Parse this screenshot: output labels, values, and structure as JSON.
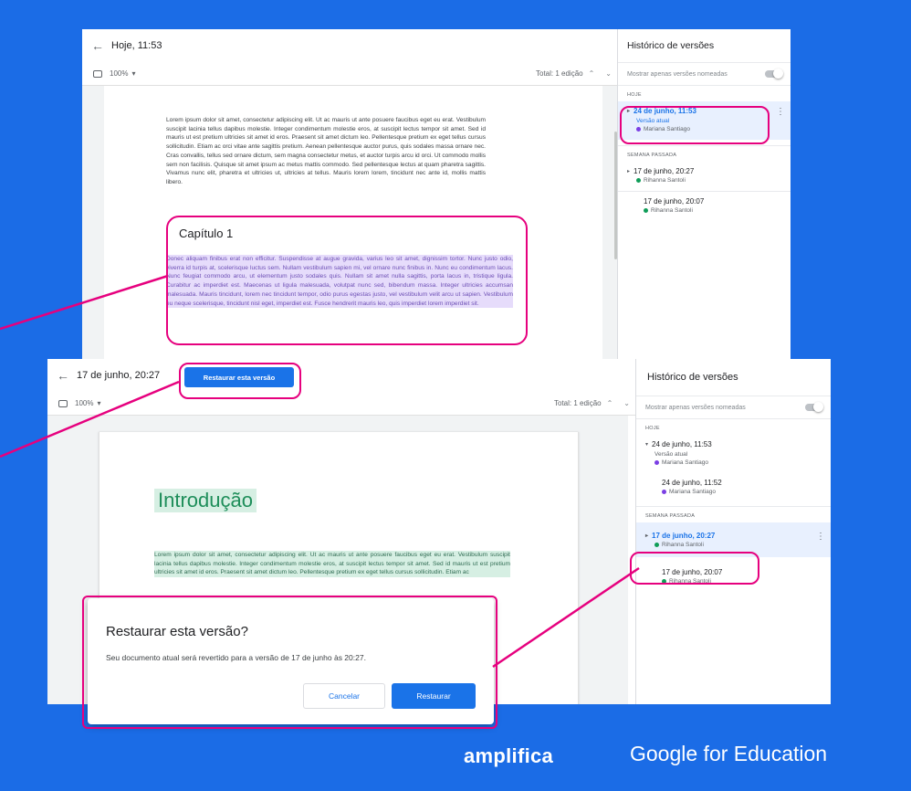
{
  "back_window": {
    "title": "Hoje, 11:53",
    "zoom": "100%",
    "total": "Total: 1 edição",
    "body_paragraph": "Lorem ipsum dolor sit amet, consectetur adipiscing elit. Ut ac mauris ut ante posuere faucibus eget eu erat. Vestibulum suscipit lacinia tellus dapibus molestie. Integer condimentum molestie eros, at suscipit lectus tempor sit amet. Sed id mauris ut est pretium ultricies sit amet id eros. Praesent sit amet dictum leo. Pellentesque pretium ex eget tellus cursus sollicitudin. Etiam ac orci vitae ante sagittis pretium. Aenean pellentesque auctor purus, quis sodales massa ornare nec. Cras convallis, tellus sed ornare dictum, sem magna consectetur metus, et auctor turpis arcu id orci. Ut commodo mollis sem non facilisis. Quisque sit amet ipsum ac metus mattis commodo. Sed pellentesque lectus at quam pharetra sagittis. Vivamus nunc elit, pharetra et ultricies ut, ultricies at tellus. Mauris lorem lorem, tincidunt nec ante id, mollis mattis libero.",
    "chapter_heading": "Capítulo 1",
    "chapter_paragraph": "Donec aliquam finibus erat non efficitur. Suspendisse at augue gravida, varius leo sit amet, dignissim tortor. Nunc justo odio, viverra id turpis at, scelerisque luctus sem. Nullam vestibulum sapien mi, vel ornare nunc finibus in. Nunc eu condimentum lacus. Nunc feugiat commodo arcu, ut elementum justo sodales quis. Nullam sit amet nulla sagittis, porta lacus in, tristique ligula. Curabitur ac imperdiet est. Maecenas ut ligula malesuada, volutpat nunc sed, bibendum massa. Integer ultricies accumsan malesuada. Mauris tincidunt, lorem nec tincidunt tempor, odio purus egestas justo, vel vestibulum velit arcu ut sapien. Vestibulum eu neque scelerisque, tincidunt nisl eget, imperdiet est. Fusce hendrerit mauris leo, quis imperdiet lorem imperdiet sit.",
    "sidebar": {
      "title": "Histórico de versões",
      "toggle_label": "Mostrar apenas versões nomeadas",
      "group_today": "HOJE",
      "group_last_week": "SEMANA PASSADA",
      "versions": [
        {
          "date": "24 de junho, 11:53",
          "sub": "Versão atual",
          "user": "Mariana Santiago",
          "user_color": "#7b3fe4"
        },
        {
          "date": "17 de junho, 20:27",
          "user": "Rihanna Santoli",
          "user_color": "#0f9d58"
        },
        {
          "date": "17 de junho, 20:07",
          "user": "Rihanna Santoli",
          "user_color": "#0f9d58"
        }
      ]
    }
  },
  "front_window": {
    "title": "17 de junho, 20:27",
    "restore_button": "Restaurar esta versão",
    "zoom": "100%",
    "total": "Total: 1 edição",
    "heading": "Introdução",
    "body_paragraph": "Lorem ipsum dolor sit amet, consectetur adipiscing elit. Ut ac mauris ut ante posuere faucibus eget eu erat. Vestibulum suscipit lacinia tellus dapibus molestie. Integer condimentum molestie eros, at suscipit lectus tempor sit amet. Sed id mauris ut est pretium ultricies sit amet id eros. Praesent sit amet dictum leo. Pellentesque pretium ex eget tellus cursus sollicitudin. Etiam ac",
    "sidebar": {
      "title": "Histórico de versões",
      "toggle_label": "Mostrar apenas versões nomeadas",
      "group_today": "HOJE",
      "group_last_week": "SEMANA PASSADA",
      "versions": [
        {
          "date": "24 de junho, 11:53",
          "sub": "Versão atual",
          "user": "Mariana Santiago",
          "user_color": "#7b3fe4"
        },
        {
          "date": "24 de junho, 11:52",
          "user": "Mariana Santiago",
          "user_color": "#7b3fe4"
        },
        {
          "date": "17 de junho, 20:27",
          "user": "Rihanna Santoli",
          "user_color": "#0f9d58"
        },
        {
          "date": "17 de junho, 20:07",
          "user": "Rihanna Santoli",
          "user_color": "#0f9d58"
        }
      ]
    }
  },
  "dialog": {
    "title": "Restaurar esta versão?",
    "message": "Seu documento atual será revertido para a versão de 17 de junho às 20:27.",
    "cancel": "Cancelar",
    "confirm": "Restaurar"
  },
  "branding": {
    "amplifica": "amplifica",
    "google": "Google for Education"
  },
  "colors": {
    "background": "#1b6ce6",
    "accent": "#1a73e8",
    "callout": "#e6007e"
  }
}
